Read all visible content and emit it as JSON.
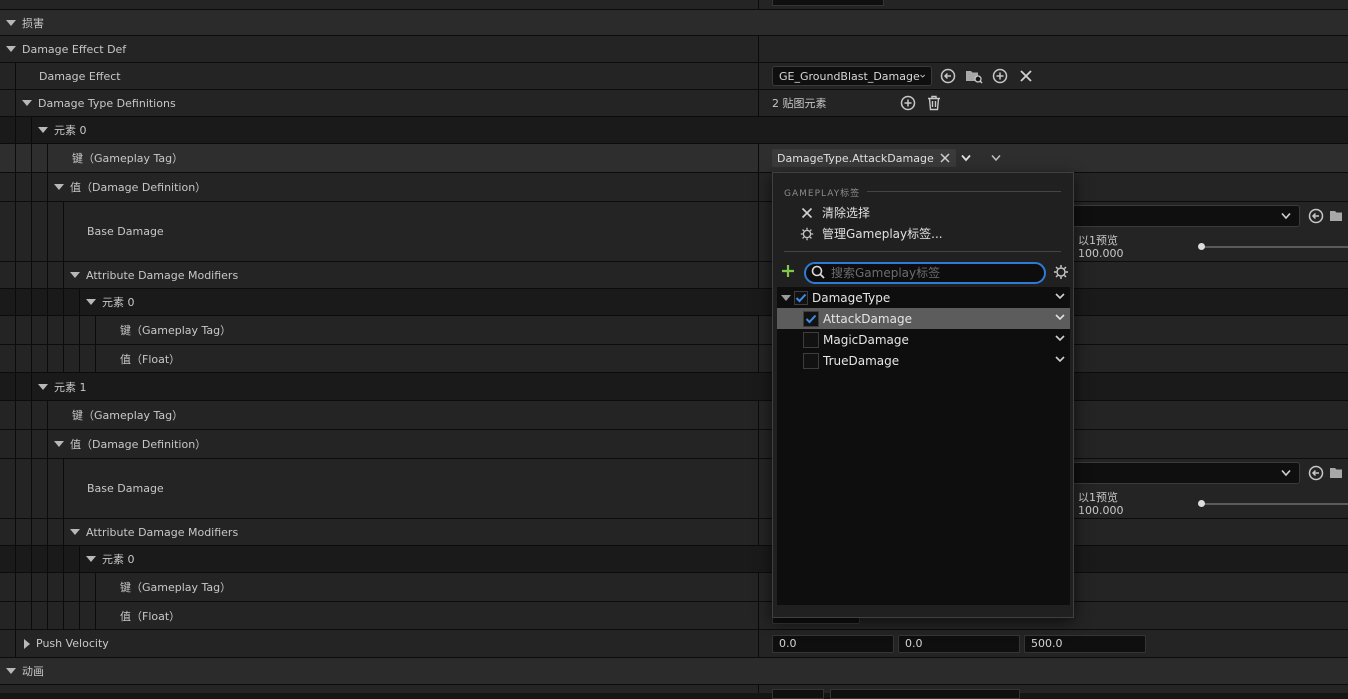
{
  "categories": {
    "damage": "损害",
    "animation": "动画"
  },
  "damage_effect_def": {
    "label": "Damage Effect Def",
    "damage_effect": {
      "label": "Damage Effect",
      "value": "GE_GroundBlast_Damage"
    },
    "damage_type_definitions": {
      "label": "Damage Type Definitions",
      "count": "2 贴图元素"
    }
  },
  "elements": [
    {
      "label": "元素 0",
      "key_label": "键（Gameplay Tag）",
      "key_value": "DamageType.AttackDamage",
      "value_label": "值（Damage Definition）",
      "base_damage_label": "Base Damage",
      "preview_label": "以1预览",
      "preview_value": "100.000",
      "modifiers_label": "Attribute Damage Modifiers",
      "mod_element_label": "元素 0",
      "mod_key_label": "键（Gameplay Tag）",
      "mod_value_label": "值（Float）"
    },
    {
      "label": "元素 1",
      "key_label": "键（Gameplay Tag）",
      "value_label": "值（Damage Definition）",
      "base_damage_label": "Base Damage",
      "preview_label": "以1预览",
      "preview_value": "100.000",
      "modifiers_label": "Attribute Damage Modifiers",
      "mod_element_label": "元素 0",
      "mod_key_label": "键（Gameplay Tag）",
      "mod_value_label": "值（Float）"
    }
  ],
  "push_velocity": {
    "label": "Push Velocity",
    "x": "0.0",
    "y": "0.0",
    "z": "500.0"
  },
  "tag_popup": {
    "header": "GAMEPLAY标签",
    "clear_selection": "清除选择",
    "manage_tags": "管理Gameplay标签...",
    "search_placeholder": "搜索Gameplay标签",
    "tree": [
      {
        "label": "DamageType",
        "checked": true
      },
      {
        "label": "AttackDamage",
        "checked": true,
        "selected": true
      },
      {
        "label": "MagicDamage",
        "checked": false
      },
      {
        "label": "TrueDamage",
        "checked": false
      }
    ]
  },
  "colors": {
    "accent": "#2e7bd6",
    "add_green": "#7ec94b",
    "check_blue": "#3d8ee8"
  }
}
